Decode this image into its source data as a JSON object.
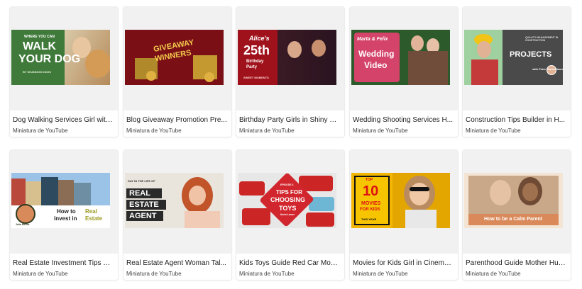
{
  "template_type": "Miniatura de YouTube",
  "cards": [
    {
      "title": "Dog Walking Services Girl with...",
      "thumb_text": [
        "WHERE YOU CAN",
        "WALK",
        "YOUR DOG",
        "BY SHANNON DAVIS"
      ]
    },
    {
      "title": "Blog Giveaway Promotion Pre...",
      "thumb_text": [
        "GIVEAWAY",
        "WINNERS"
      ]
    },
    {
      "title": "Birthday Party Girls in Shiny D...",
      "thumb_text": [
        "Alice's",
        "25th",
        "Birthday",
        "Party",
        "SWEET MOMENTS"
      ]
    },
    {
      "title": "Wedding Shooting Services H...",
      "thumb_text": [
        "Marta & Felix",
        "Wedding",
        "Video"
      ]
    },
    {
      "title": "Construction Tips Builder in H...",
      "thumb_text": [
        "QUALITY MANAGEMENT IN CONSTRUCTION",
        "PROJECTS",
        "with Peter Samueltson"
      ]
    },
    {
      "title": "Real Estate Investment Tips M...",
      "thumb_text": [
        "How to",
        "invest in",
        "Real",
        "Estate",
        "Julia Becka"
      ]
    },
    {
      "title": "Real Estate Agent Woman Tal...",
      "thumb_text": [
        "DAY IN THE LIFE OF",
        "REAL",
        "ESTATE",
        "AGENT"
      ]
    },
    {
      "title": "Kids Toys Guide Red Car Models",
      "thumb_text": [
        "EPISODE 4",
        "TIPS FOR",
        "CHOOSING",
        "TOYS",
        "Karin Lanov"
      ]
    },
    {
      "title": "Movies for Kids Girl in Cinema i...",
      "thumb_text": [
        "TOP",
        "10",
        "MOVIES",
        "FOR KIDS",
        "THIS YEAR"
      ]
    },
    {
      "title": "Parenthood Guide Mother Hug...",
      "thumb_text": [
        "How to be a Calm Parent"
      ]
    }
  ],
  "colors": {
    "page_bg": "#ffffff",
    "card_preview_bg": "#f1f1f1",
    "title": "#222222",
    "subtitle": "#444444"
  }
}
